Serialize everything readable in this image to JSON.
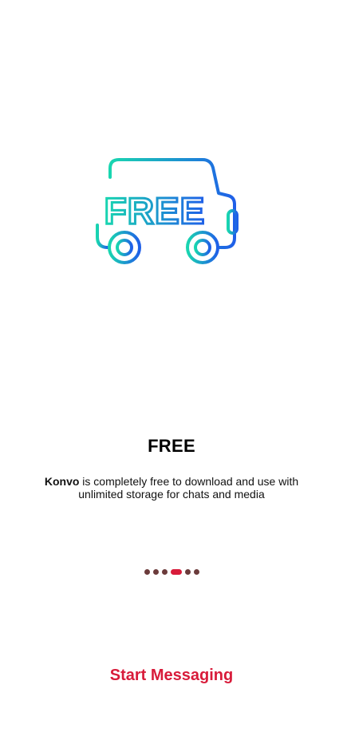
{
  "onboarding": {
    "illustration_icon": "free-delivery-truck-icon",
    "illustration_text": "FREE",
    "title": "FREE",
    "description_brand": "Konvo",
    "description_rest": " is completely free to download and use with unlimited storage for chats and media"
  },
  "pagination": {
    "total": 6,
    "active_index": 3
  },
  "actions": {
    "start_label": "Start Messaging"
  },
  "colors": {
    "accent": "#d81b3a",
    "dot_inactive": "#6b3b3b",
    "gradient_start": "#19d6b0",
    "gradient_end": "#1f5fe8"
  }
}
